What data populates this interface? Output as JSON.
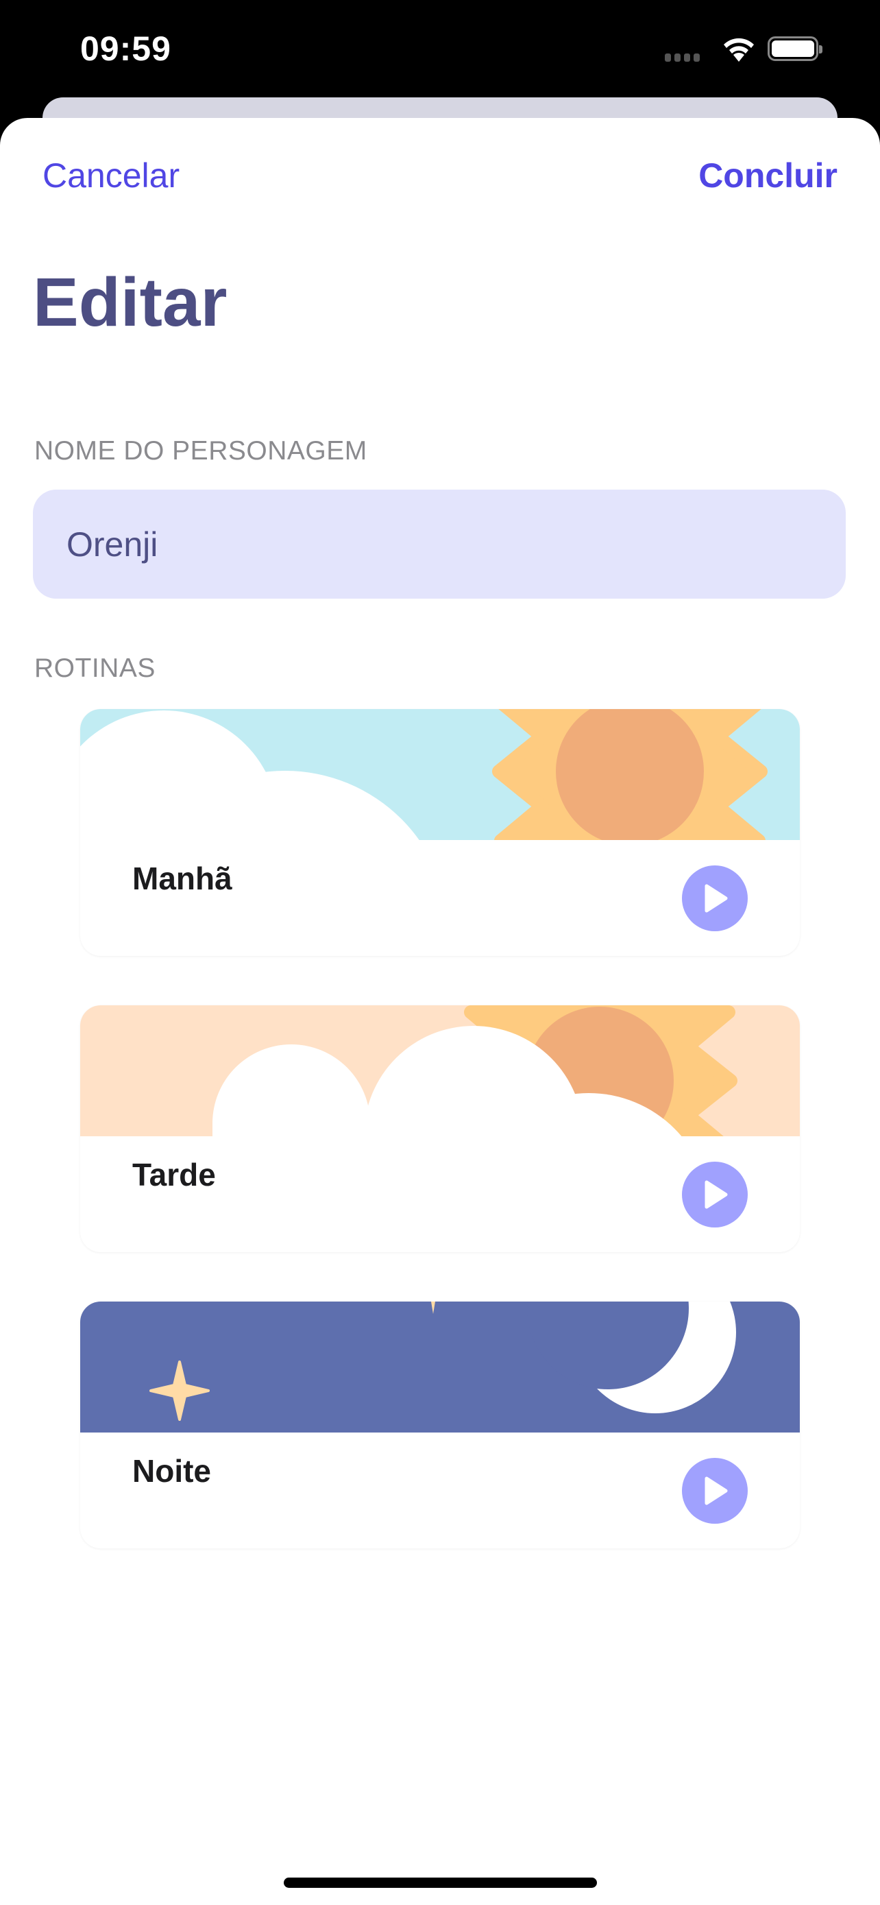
{
  "status_bar": {
    "time": "09:59",
    "wifi_icon": "wifi-icon",
    "battery_icon": "battery-icon"
  },
  "nav": {
    "cancel_label": "Cancelar",
    "done_label": "Concluir"
  },
  "page_title": "Editar",
  "character": {
    "section_label": "NOME DO PERSONAGEM",
    "name_value": "Orenji"
  },
  "routines": {
    "section_label": "ROTINAS",
    "items": [
      {
        "label": "Manhã",
        "illustration": "morning-sun-cloud",
        "action_icon": "play-icon"
      },
      {
        "label": "Tarde",
        "illustration": "afternoon-sun-cloud",
        "action_icon": "play-icon"
      },
      {
        "label": "Noite",
        "illustration": "night-moon-stars",
        "action_icon": "play-icon"
      }
    ]
  },
  "colors": {
    "accent": "#5046E4",
    "title": "#4D4E83",
    "field_bg": "#E3E4FC",
    "play": "#A0A1FE",
    "morning_sky": "#C1ECF3",
    "afternoon_sky": "#FFE1C7",
    "night_sky": "#5E6FAE",
    "sun_outer": "#FECB80",
    "sun_inner": "#F0AC79"
  }
}
